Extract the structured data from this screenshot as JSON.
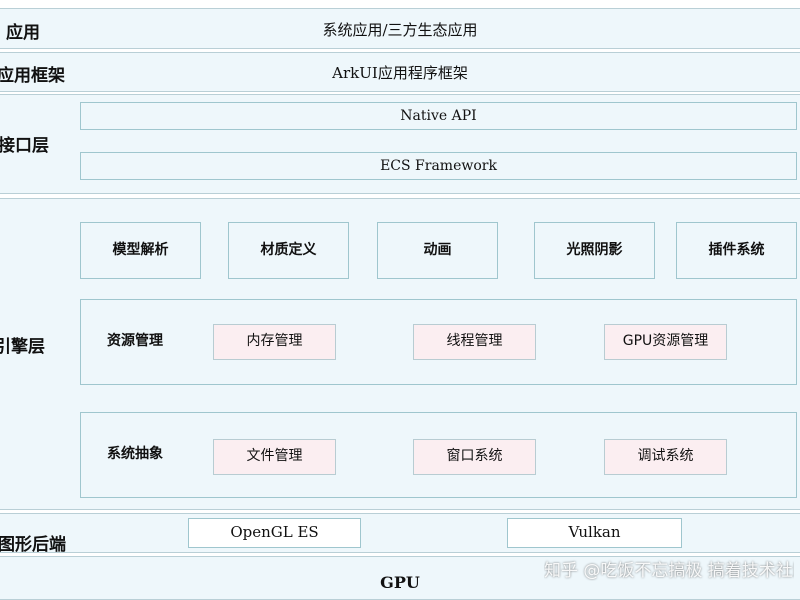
{
  "layers": {
    "application": {
      "label": "应用",
      "content": "系统应用/三方生态应用"
    },
    "framework": {
      "label": "应用框架",
      "content": "ArkUI应用程序框架"
    },
    "interface": {
      "label": "接口层",
      "bars": [
        "Native API",
        "ECS Framework"
      ]
    },
    "engine": {
      "label": "引擎层",
      "modules": [
        "模型解析",
        "材质定义",
        "动画",
        "光照阴影",
        "插件系统"
      ],
      "resource": {
        "label": "资源管理",
        "items": [
          "内存管理",
          "线程管理",
          "GPU资源管理"
        ]
      },
      "system": {
        "label": "系统抽象",
        "items": [
          "文件管理",
          "窗口系统",
          "调试系统"
        ]
      }
    },
    "graphics": {
      "label": "图形后端",
      "items": [
        "OpenGL ES",
        "Vulkan"
      ]
    },
    "gpu": {
      "content": "GPU"
    }
  },
  "watermark": "知乎 @吃饭不忘搞极 搞着技术社区 @ 极客公"
}
